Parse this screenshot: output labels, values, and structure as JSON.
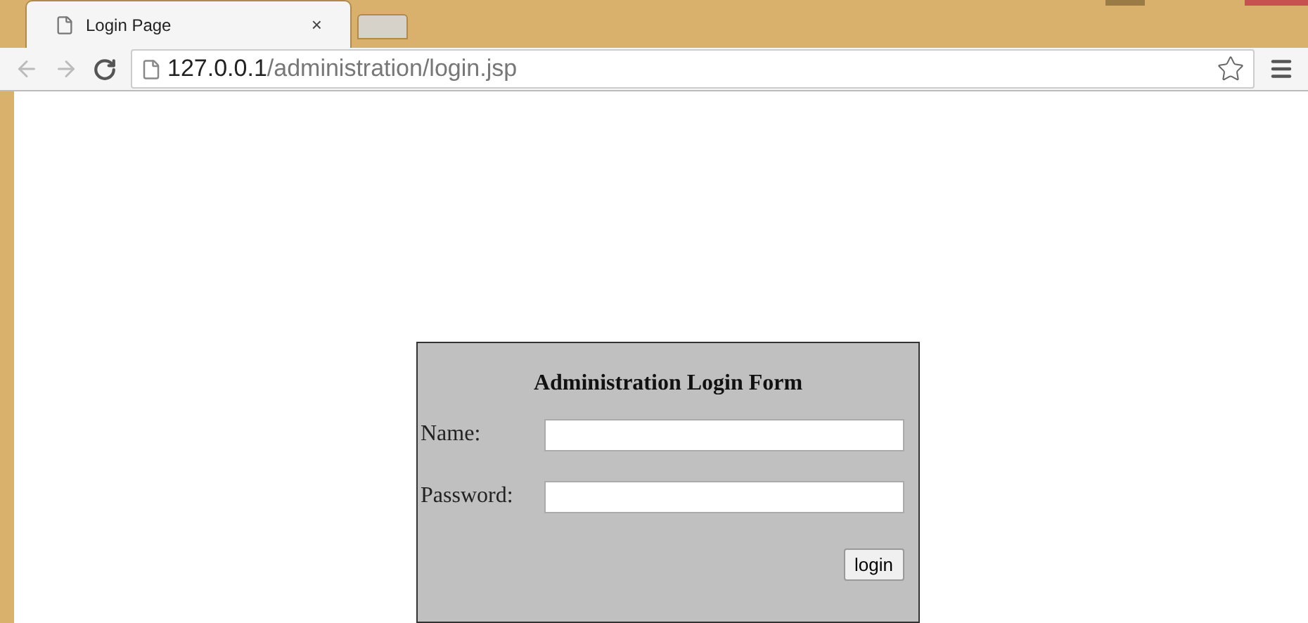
{
  "tabs": [
    {
      "title": "Login Page",
      "close": "×",
      "selected": true
    },
    {
      "selected": false
    }
  ],
  "address_bar": {
    "host": "127.0.0.1",
    "path": "/administration/login.jsp"
  },
  "form": {
    "title": "Administration Login Form",
    "fields": [
      {
        "label": "Name:"
      },
      {
        "label": "Password:"
      }
    ],
    "button": "login"
  }
}
